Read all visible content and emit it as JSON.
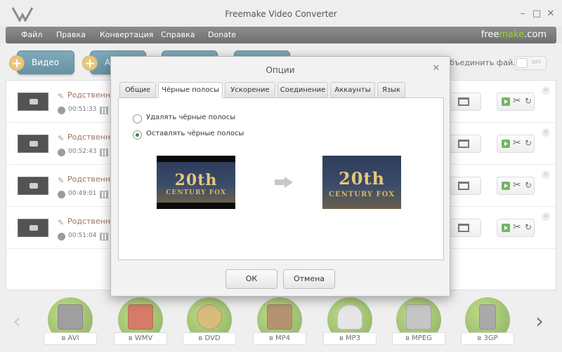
{
  "window": {
    "title": "Freemake Video Converter",
    "minimize": "–",
    "maximize": "□",
    "close": "✕"
  },
  "menu": {
    "items": [
      "Файл",
      "Правка",
      "Конвертация",
      "Справка",
      "Donate"
    ],
    "brand_main": "free",
    "brand_accent": "make",
    "brand_suffix": ".com"
  },
  "toolbar": {
    "add_video": "Видео",
    "add_audio": "А",
    "plus": "+",
    "join_files": "бъединить файлы",
    "toggle_state": "OFF"
  },
  "files": [
    {
      "name": "Родственнич",
      "duration": "00:51:33"
    },
    {
      "name": "Родственнич",
      "duration": "00:52:43"
    },
    {
      "name": "Родственнич",
      "duration": "00:49:01"
    },
    {
      "name": "Родственнич",
      "duration": "00:51:04"
    }
  ],
  "formats": [
    {
      "label": "в AVI",
      "color": "#7a7a7a"
    },
    {
      "label": "в WMV",
      "color": "#c44a2e"
    },
    {
      "label": "в DVD",
      "color": "#c9a24a"
    },
    {
      "label": "в MP4",
      "color": "#9a6a3a"
    },
    {
      "label": "в MP3",
      "color": "#dddddd"
    },
    {
      "label": "в MPEG",
      "color": "#b0b0b0"
    },
    {
      "label": "в 3GP",
      "color": "#8a8a8a"
    }
  ],
  "nav": {
    "prev": "‹",
    "next": "›"
  },
  "dialog": {
    "title": "Опции",
    "close": "✕",
    "tabs": [
      "Общие",
      "Чёрные полосы",
      "Ускорение",
      "Соединение",
      "Аккаунты",
      "Язык"
    ],
    "active_tab": 1,
    "options": [
      {
        "label": "Удалять чёрные полосы",
        "checked": false
      },
      {
        "label": "Оставлять чёрные полосы",
        "checked": true
      }
    ],
    "preview_logo": "20th",
    "preview_sub": "CENTURY FOX",
    "ok": "ОК",
    "cancel": "Отмена"
  },
  "colors": {
    "accent_green": "#9fd13a",
    "button_blue": "#2f6a83",
    "menubar": "#7c7c7c"
  }
}
